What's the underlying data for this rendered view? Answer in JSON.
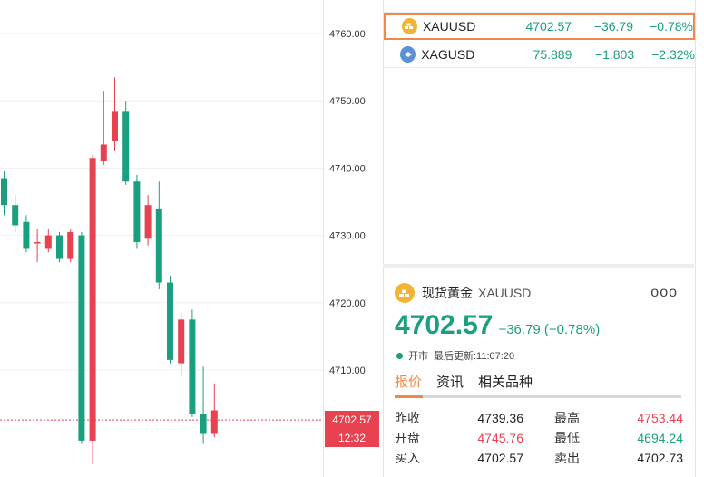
{
  "chart": {
    "y_ticks": [
      "4760.00",
      "4750.00",
      "4740.00",
      "4730.00",
      "4720.00",
      "4710.00"
    ],
    "y_tick_values": [
      4760,
      4750,
      4740,
      4730,
      4720,
      4710
    ],
    "current_price_label": "4702.57",
    "countdown_label": "12:32",
    "current_price": 4702.57,
    "up_color": "#e8414f",
    "down_color": "#1a9f7f",
    "candles": [
      {
        "o": 4738.5,
        "h": 4739.5,
        "l": 4733.0,
        "c": 4734.5
      },
      {
        "o": 4734.5,
        "h": 4736.0,
        "l": 4730.5,
        "c": 4731.5
      },
      {
        "o": 4732.0,
        "h": 4733.0,
        "l": 4727.5,
        "c": 4728.0
      },
      {
        "o": 4729.0,
        "h": 4731.0,
        "l": 4726.0,
        "c": 4729.0
      },
      {
        "o": 4728.0,
        "h": 4731.0,
        "l": 4727.5,
        "c": 4730.0
      },
      {
        "o": 4730.0,
        "h": 4730.5,
        "l": 4726.0,
        "c": 4726.5
      },
      {
        "o": 4726.5,
        "h": 4731.0,
        "l": 4726.0,
        "c": 4730.5
      },
      {
        "o": 4730.0,
        "h": 4730.5,
        "l": 4699.0,
        "c": 4699.5
      },
      {
        "o": 4699.5,
        "h": 4742.0,
        "l": 4696.0,
        "c": 4741.5
      },
      {
        "o": 4741.0,
        "h": 4751.5,
        "l": 4740.5,
        "c": 4743.5
      },
      {
        "o": 4744.0,
        "h": 4753.5,
        "l": 4742.5,
        "c": 4748.5
      },
      {
        "o": 4748.5,
        "h": 4750.0,
        "l": 4737.5,
        "c": 4738.0
      },
      {
        "o": 4738.0,
        "h": 4739.0,
        "l": 4728.0,
        "c": 4729.0
      },
      {
        "o": 4729.5,
        "h": 4736.0,
        "l": 4728.5,
        "c": 4734.5
      },
      {
        "o": 4734.0,
        "h": 4738.0,
        "l": 4722.0,
        "c": 4723.0
      },
      {
        "o": 4723.0,
        "h": 4724.0,
        "l": 4711.0,
        "c": 4711.5
      },
      {
        "o": 4711.0,
        "h": 4718.5,
        "l": 4709.0,
        "c": 4717.5
      },
      {
        "o": 4717.5,
        "h": 4719.0,
        "l": 4703.0,
        "c": 4703.5
      },
      {
        "o": 4703.5,
        "h": 4710.5,
        "l": 4699.0,
        "c": 4700.5
      },
      {
        "o": 4700.5,
        "h": 4708.0,
        "l": 4700.0,
        "c": 4704.0
      }
    ]
  },
  "watchlist": {
    "rows": [
      {
        "symbol": "XAUUSD",
        "price": "4702.57",
        "change": "−36.79",
        "percent": "−0.78%",
        "icon": "gold-coin-icon",
        "icon_color": "#f2b531",
        "selected": true
      },
      {
        "symbol": "XAGUSD",
        "price": "75.889",
        "change": "−1.803",
        "percent": "−2.32%",
        "icon": "silver-coin-icon",
        "icon_color": "#5b8fd6",
        "selected": false
      }
    ]
  },
  "detail": {
    "name": "现货黄金",
    "symbol": "XAUUSD",
    "more_label": "ooo",
    "price": "4702.57",
    "change": "−36.79 (−0.78%)",
    "status_label": "开市",
    "updated_label": "最后更新:11:07:20",
    "tabs": [
      "报价",
      "资讯",
      "相关品种"
    ],
    "active_tab": 0,
    "quote": [
      {
        "label1": "昨收",
        "value1": "4739.36",
        "color1": "",
        "label2": "最高",
        "value2": "4753.44",
        "color2": "red"
      },
      {
        "label1": "开盘",
        "value1": "4745.76",
        "color1": "red",
        "label2": "最低",
        "value2": "4694.24",
        "color2": "green"
      },
      {
        "label1": "买入",
        "value1": "4702.57",
        "color1": "",
        "label2": "卖出",
        "value2": "4702.73",
        "color2": ""
      }
    ]
  }
}
